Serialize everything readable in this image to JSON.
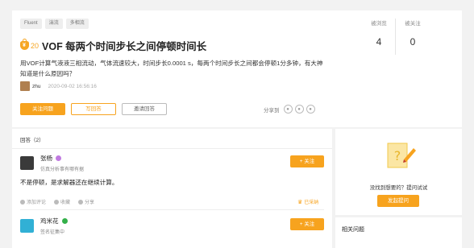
{
  "question": {
    "tags": [
      "Fluent",
      "湍流",
      "多相流"
    ],
    "reward": "20",
    "title": "VOF 每两个时间步长之间停顿时间长",
    "description": "用VOF计算气液液三相流动，气体流速较大，时间步长0.0001 s，每两个时间步长之间都会停顿1分多钟，有大神知道是什么原因吗？",
    "author": "zhu",
    "date": "2020-09-02 16:56:16",
    "buttons": {
      "follow": "关注问题",
      "write": "写回答",
      "invite": "邀请回答"
    },
    "share_label": "分享到",
    "stats": {
      "views_label": "被浏览",
      "views": "4",
      "followers_label": "被关注",
      "followers": "0"
    }
  },
  "answers": {
    "header": "回答（2）",
    "items": [
      {
        "name": "张杨",
        "desc": "仿真分析事有哪有据",
        "follow_label": "+ 关注",
        "body": "不是停顿，是求解器还在继续计算。",
        "actions": [
          "添加评论",
          "收藏",
          "分享"
        ],
        "adopted": "已采纳"
      },
      {
        "name": "鸡米花",
        "desc": "签名征集中",
        "follow_label": "+ 关注"
      }
    ]
  },
  "sidebar": {
    "empty_text": "没找到想要的？提问试试",
    "ask_button": "发起提问",
    "related_title": "相关问题"
  },
  "colors": {
    "accent": "#f7a31e"
  }
}
